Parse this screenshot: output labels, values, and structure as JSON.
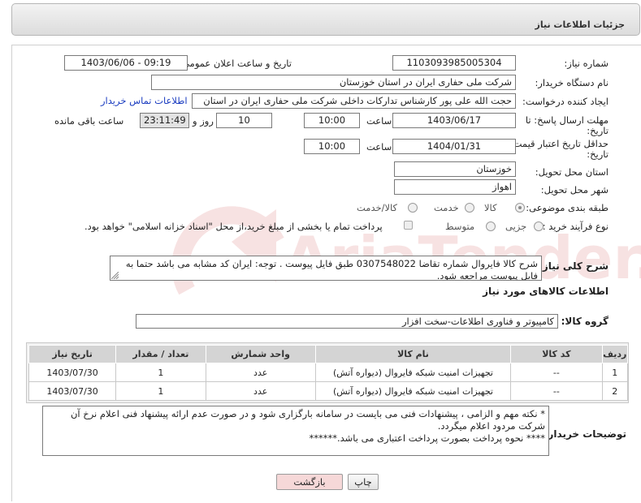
{
  "header": {
    "title": "جزئیات اطلاعات نیاز"
  },
  "fields": {
    "need_number_label": "شماره نیاز:",
    "need_number": "1103093985005304",
    "announce_label": "تاریخ و ساعت اعلان عمومی:",
    "announce_value": "1403/06/06 - 09:19",
    "buyer_org_label": "نام دستگاه خریدار:",
    "buyer_org": "شرکت ملی حفاری ایران در استان خوزستان",
    "creator_label": "ایجاد کننده درخواست:",
    "creator": "حجت الله علی پور کارشناس تدارکات داخلی شرکت ملی حفاری ایران در استان",
    "contact_link": "اطلاعات تماس خریدار",
    "deadline_label_1": "مهلت ارسال پاسخ: تا",
    "deadline_label_2": "تاریخ:",
    "deadline_date": "1403/06/17",
    "time_label": "ساعت",
    "deadline_time": "10:00",
    "days_value": "10",
    "days_label": "روز و",
    "remaining_time": "23:11:49",
    "remaining_label": "ساعت باقی مانده",
    "validity_label_1": "حداقل تاریخ اعتبار قیمت: تا",
    "validity_label_2": "تاریخ:",
    "validity_date": "1404/01/31",
    "validity_time_label": "ساعت",
    "validity_time": "10:00",
    "province_label": "استان محل تحویل:",
    "province": "خوزستان",
    "city_label": "شهر محل تحویل:",
    "city": "اهواز",
    "category_label": "طبقه بندی موضوعی:",
    "category_options": [
      "کالا",
      "خدمت",
      "کالا/خدمت"
    ],
    "category_selected": "کالا",
    "process_label": "نوع فرآیند خرید :",
    "process_options": [
      "جزیی",
      "متوسط"
    ],
    "payment_note": "پرداخت تمام یا بخشی از مبلغ خرید،از محل \"اسناد خزانه اسلامی\" خواهد بود."
  },
  "description": {
    "label": "شرح کلی نیاز:",
    "text": "شرح کالا فایروال شماره تقاضا 0307548022 طبق فایل پیوست . توجه: ایران کد مشابه می باشد حتما به فایل پیوست مراجعه شود."
  },
  "goods_section": {
    "title": "اطلاعات کالاهای مورد نیاز",
    "group_label": "گروه کالا:",
    "group_value": "کامپیوتر و فناوری اطلاعات-سخت افزار"
  },
  "table": {
    "headers": [
      "ردیف",
      "کد کالا",
      "نام کالا",
      "واحد شمارش",
      "تعداد / مقدار",
      "تاریخ نیاز"
    ],
    "rows": [
      [
        "1",
        "--",
        "تجهیزات امنیت شبکه فایروال (دیواره آتش)",
        "عدد",
        "1",
        "1403/07/30"
      ],
      [
        "2",
        "--",
        "تجهیزات امنیت شبکه فایروال (دیواره آتش)",
        "عدد",
        "1",
        "1403/07/30"
      ]
    ]
  },
  "buyer_notes": {
    "label": "توضیحات خریدار:",
    "line1": "* نکته مهم و الزامی ، پیشنهادات فنی می بایست در سامانه بارگزاری شود و در صورت عدم ارائه پیشنهاد فنی اعلام نرخ آن شرکت مردود اعلام میگردد.",
    "line2": "**** نحوه پرداخت بصورت پرداخت اعتباری می باشد.******"
  },
  "buttons": {
    "print": "چاپ",
    "back": "بازگشت"
  },
  "watermark": {
    "text": "AriaTender.net"
  },
  "colors": {
    "link": "#1a3cc0",
    "back_button_bg": "#f6d8d8",
    "watermark": "#c62828"
  }
}
